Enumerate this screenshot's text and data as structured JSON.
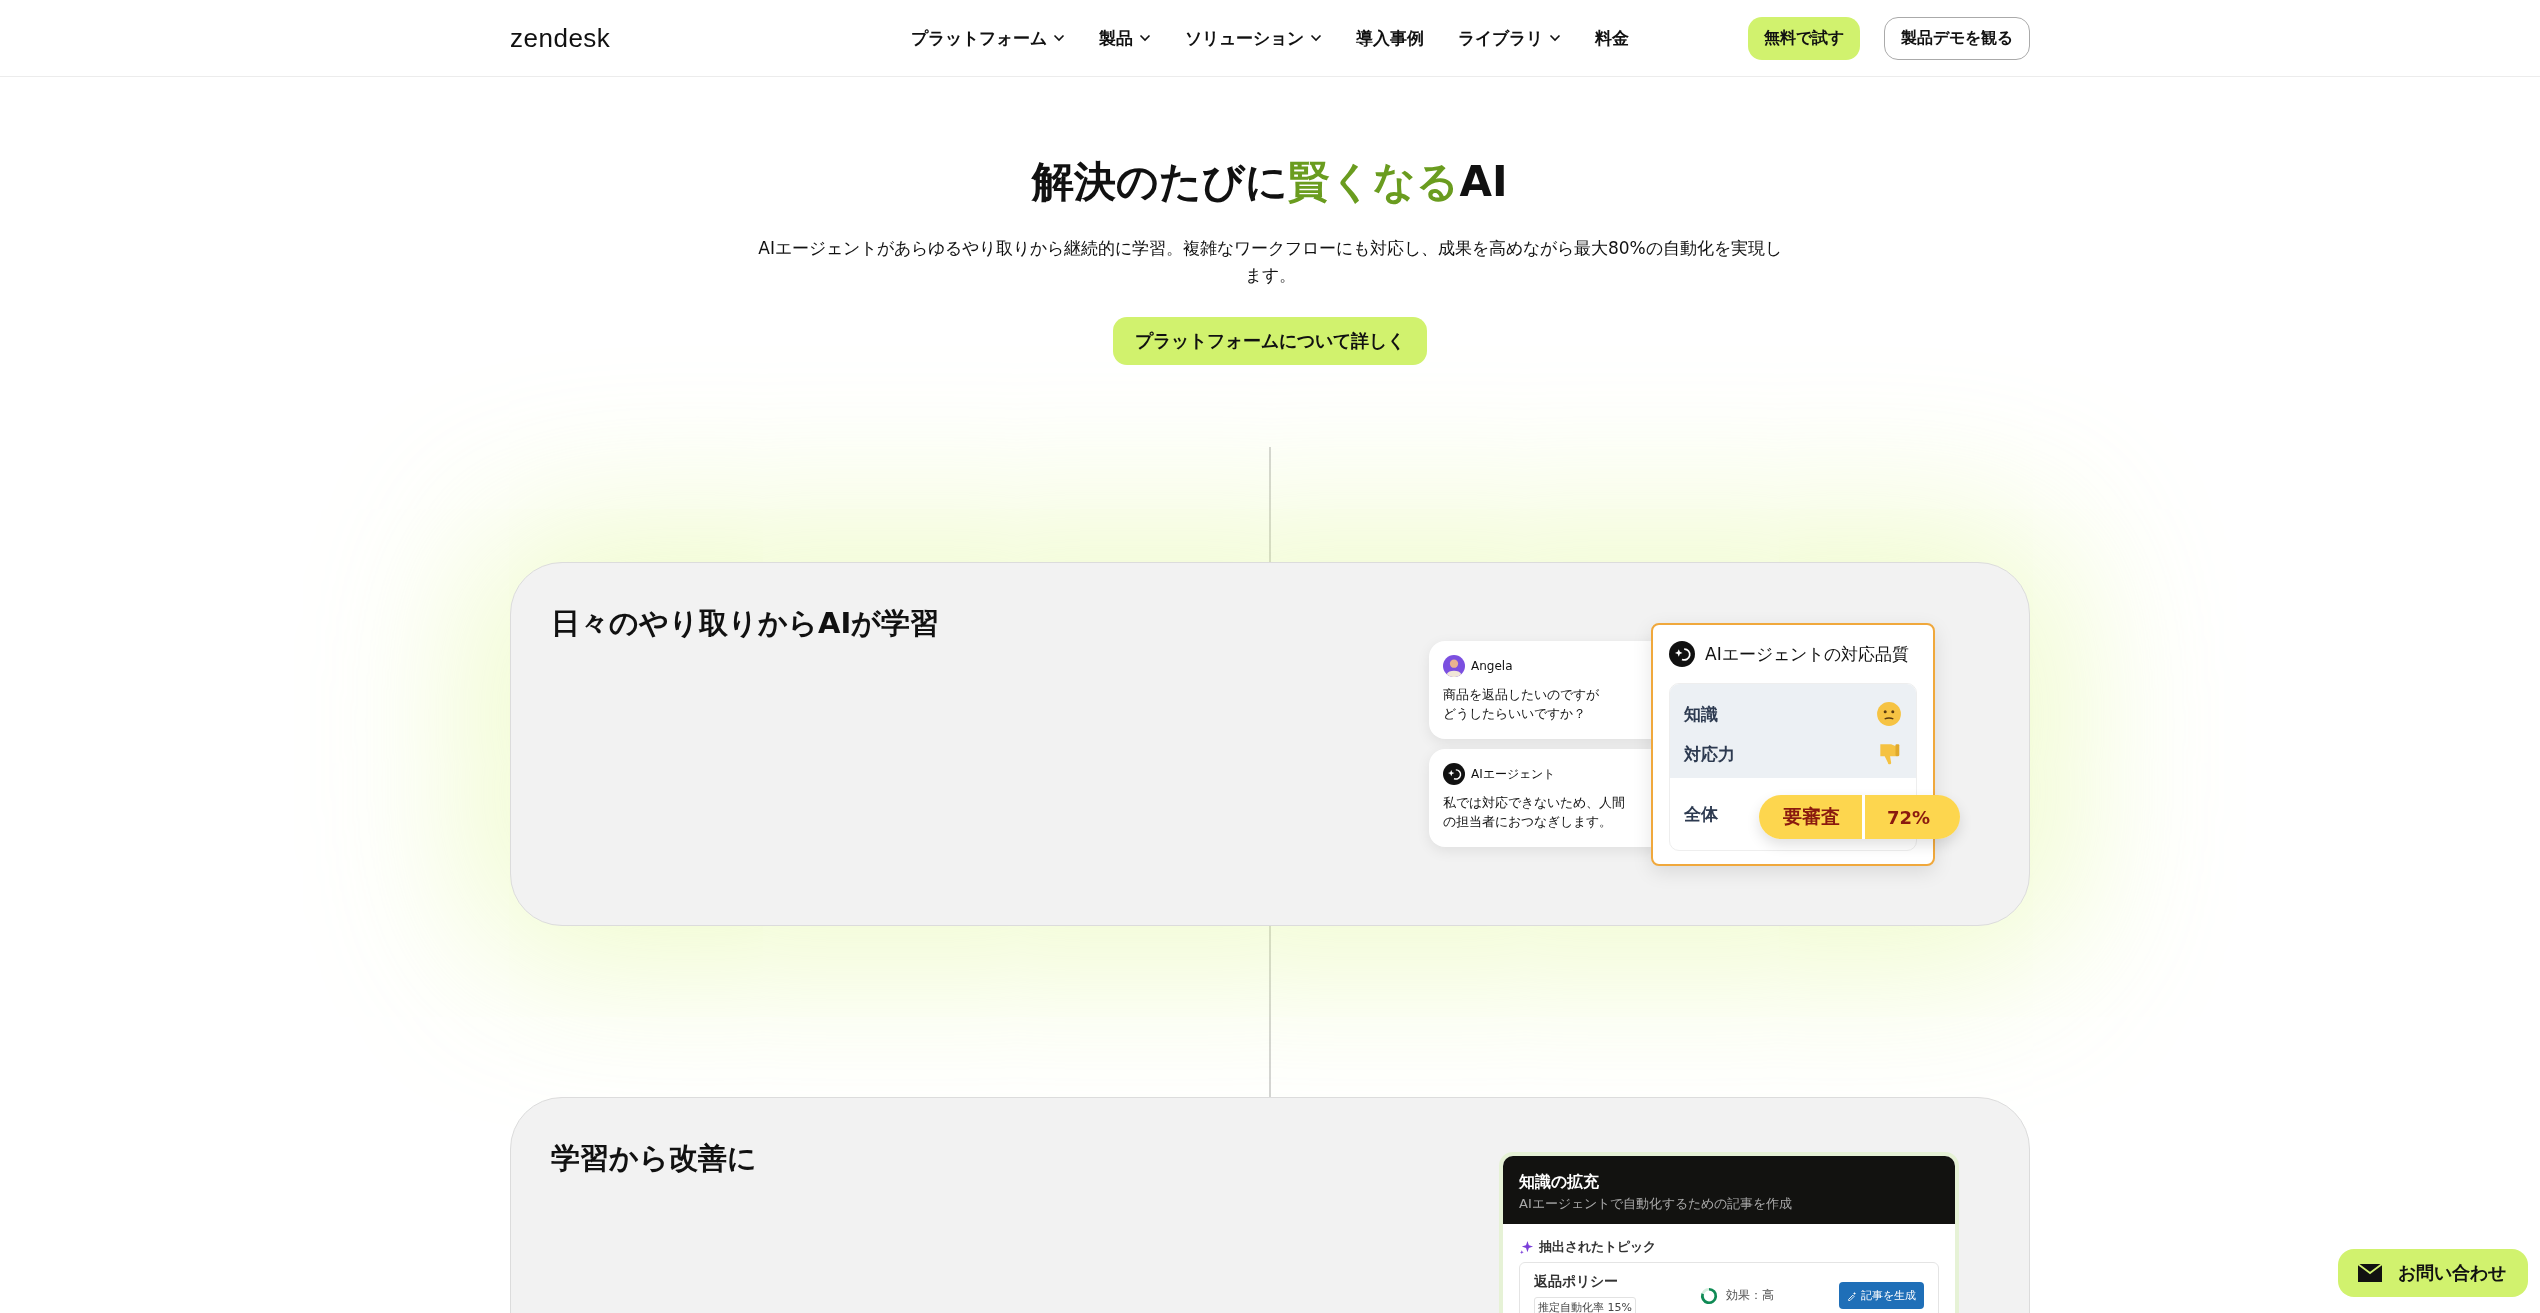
{
  "header": {
    "logo": "zendesk",
    "menu": [
      {
        "label": "プラットフォーム",
        "dropdown": true
      },
      {
        "label": "製品",
        "dropdown": true
      },
      {
        "label": "ソリューション",
        "dropdown": true
      },
      {
        "label": "導入事例",
        "dropdown": false
      },
      {
        "label": "ライブラリ",
        "dropdown": true
      },
      {
        "label": "料金",
        "dropdown": false
      }
    ],
    "buttons": [
      {
        "label": "無料で試す",
        "kind": "primary"
      },
      {
        "label": "製品デモを観る",
        "kind": "outline"
      }
    ]
  },
  "hero": {
    "title_parts": [
      {
        "text": "解決のたびに",
        "highlight": false
      },
      {
        "text": "賢くなる",
        "highlight": true
      },
      {
        "text": "AI",
        "highlight": false
      }
    ],
    "subtitle": "AIエージェントがあらゆるやり取りから継続的に学習。複雑なワークフローにも対応し、成果を高めながら最大80%の自動化を実現します。",
    "button": "プラットフォームについて詳しく"
  },
  "cards": [
    {
      "kind": "quality",
      "title": "日々のやり取りからAIが学習",
      "messages": [
        {
          "sender": "Angela",
          "kind": "person",
          "lines": [
            "商品を返品したいのですが",
            "どうしたらいいですか？"
          ]
        },
        {
          "sender": "AIエージェント",
          "kind": "agent",
          "lines": [
            "私では対応できないため、人間",
            "の担当者におつなぎします。"
          ]
        }
      ],
      "panel": {
        "title": "AIエージェントの対応品質",
        "rows": [
          {
            "label": "知識",
            "kind": "neutral"
          },
          {
            "label": "対応力",
            "kind": "negative"
          }
        ],
        "overall": "全体",
        "status": "要審査",
        "score": "72%"
      }
    },
    {
      "kind": "knowledge",
      "title": "学習から改善に",
      "panel": {
        "title": "知識の拡充",
        "subtitle": "AIエージェントで自動化するための記事を作成",
        "section": "抽出されたトピック",
        "topic": {
          "name": "返品ポリシー",
          "tag": "推定自動化率 15%",
          "effect": "効果：高",
          "button": "記事を生成"
        }
      }
    }
  ],
  "contact": "お問い合わせ"
}
